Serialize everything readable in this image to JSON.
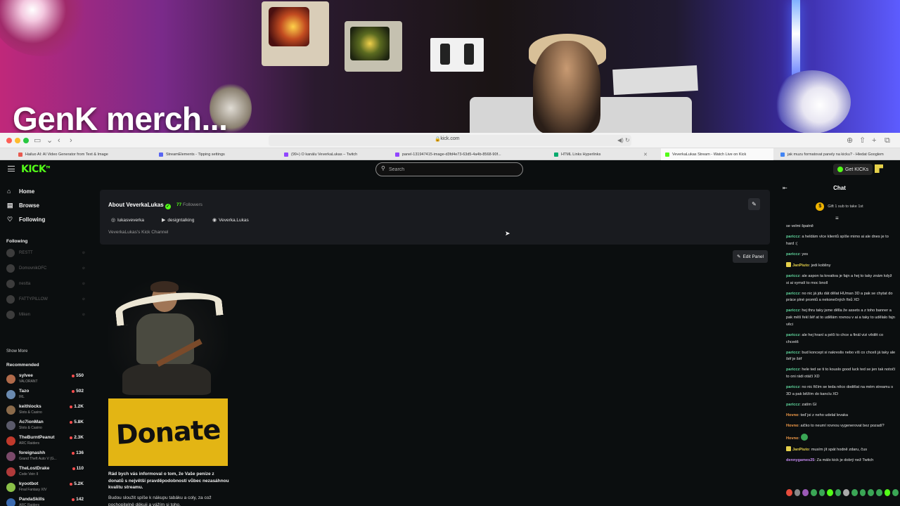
{
  "overlay": {
    "title": "GenK merch..."
  },
  "browser": {
    "url": "kick.com",
    "tabs": [
      {
        "label": "Hailuo AI: AI Video Generator from Text & Image",
        "fav": "#e85a4f"
      },
      {
        "label": "StreamElements - Tipping settings",
        "fav": "#5865f2"
      },
      {
        "label": "(99+) O kanálu VeverkaLukas – Twitch",
        "fav": "#9146ff"
      },
      {
        "label": "panel-131947415-image-d3fd4e73-63d5-4a4b-8568-90f...",
        "fav": "#9146ff"
      },
      {
        "label": "HTML Links Hyperlinks",
        "fav": "#04aa6d"
      },
      {
        "label": "VeverkaLukas Stream - Watch Live on Kick",
        "fav": "#53fc18"
      },
      {
        "label": "jak muzu formatovat panely na kicku? - Hledat Googlem",
        "fav": "#4285f4"
      }
    ]
  },
  "topnav": {
    "logo": "KICK",
    "search_placeholder": "Search",
    "get_kicks": "Get KICKs"
  },
  "sidebar": {
    "nav": [
      {
        "label": "Home",
        "icon": "⌂"
      },
      {
        "label": "Browse",
        "icon": "▤"
      },
      {
        "label": "Following",
        "icon": "♡"
      }
    ],
    "following_heading": "Following",
    "following": [
      "RESTT",
      "DomovnikOFC",
      "nestta",
      "FATTYPILLOW",
      "Miken"
    ],
    "show_more": "Show More",
    "recommended_heading": "Recommended",
    "recommended": [
      {
        "name": "sylvee",
        "category": "VALORANT",
        "viewers": "550",
        "color": "#b06a4a"
      },
      {
        "name": "Tazo",
        "category": "IRL",
        "viewers": "502",
        "color": "#6a8ab0"
      },
      {
        "name": "keithlocks",
        "category": "Slots & Casino",
        "viewers": "1.2K",
        "color": "#8a6a4a"
      },
      {
        "name": "Ac7ionMan",
        "category": "Slots & Casino",
        "viewers": "5.8K",
        "color": "#5a5a6a"
      },
      {
        "name": "TheBurntPeanut",
        "category": "ARC Raiders",
        "viewers": "2.3K",
        "color": "#c0392b"
      },
      {
        "name": "foreignashh",
        "category": "Grand Theft Auto V (G...",
        "viewers": "136",
        "color": "#7a4a6a"
      },
      {
        "name": "TheLostDrake",
        "category": "Code Vein II",
        "viewers": "110",
        "color": "#b03a3a"
      },
      {
        "name": "kyootbot",
        "category": "Final Fantasy XIV",
        "viewers": "5.2K",
        "color": "#8ac048"
      },
      {
        "name": "PandaSkills",
        "category": "ARC Raiders",
        "viewers": "142",
        "color": "#3a6ab0"
      },
      {
        "name": "withJENNY",
        "category": "Just Chatting",
        "viewers": "122",
        "color": "#c08060"
      }
    ]
  },
  "about": {
    "title": "About VeverkaLukas",
    "followers_count": "77",
    "followers_label": "Followers",
    "social": [
      {
        "label": "lukasveverka",
        "icon": "◎"
      },
      {
        "label": "designtalking",
        "icon": "▶"
      },
      {
        "label": "Veverka.Lukas",
        "icon": "◉"
      }
    ],
    "description": "VeverkaLukas's Kick Channel"
  },
  "panel": {
    "edit_label": "Edit Panel",
    "donate_text": "Donate",
    "bold_text": "Rád bych vás informoval o tom, že Vaše peníze z donatů s největší pravděpodobností vůbec nezasáhnou kvalitu streamu.",
    "body_text": "Budou sloužit spíše k nákupu tabáku a coly, za což pochopitelně děkuji a vážím si toho."
  },
  "chat": {
    "title": "Chat",
    "gift_text": "Gift 1 sub to take 1st",
    "messages": [
      {
        "user": "",
        "color": "#e6e6e6",
        "text": "se velmi špatně",
        "badge": false
      },
      {
        "user": "pariccz",
        "color": "#5fd39b",
        "text": "a heldám více klientů spíše mimo ai ale dnes je to hard :(",
        "badge": false
      },
      {
        "user": "pariccz",
        "color": "#5fd39b",
        "text": "yes",
        "badge": false
      },
      {
        "user": "JanPiuto",
        "color": "#e5d04a",
        "text": "jedi kobliny",
        "badge": true
      },
      {
        "user": "pariccz",
        "color": "#5fd39b",
        "text": "ale aspon ta kreativa je fajn a hej to taky znám když si ai vymslí to moc bnoll",
        "badge": false
      },
      {
        "user": "pariccz",
        "color": "#5fd39b",
        "text": "no nic já jdu dát dělat HUman 3D a pak se chytat do práce plné promtů a nekonečných fixů XD",
        "badge": false
      },
      {
        "user": "pariccz",
        "color": "#5fd39b",
        "text": "hej thru taky jsme dělla že assets a z toho banner a pak měš řekl šéf at to udělám rovnou v ai a taky to udělalo fajn věci",
        "badge": false
      },
      {
        "user": "pariccz",
        "color": "#5fd39b",
        "text": "ale hej hraní a péči to chce a finál vizi vědět co chceéš",
        "badge": false
      },
      {
        "user": "pariccz",
        "color": "#5fd39b",
        "text": "bud koncept si nakreslis nebo víš co chceš já taky ale šéf je šéf",
        "badge": false
      },
      {
        "user": "pariccz",
        "color": "#5fd39b",
        "text": "hele ted se ti to kouslo good luck ted se jen tak notočí to oni rádi otáčí XD",
        "badge": false
      },
      {
        "user": "pariccz",
        "color": "#5fd39b",
        "text": "no nic fičím se teda něco dodělat na mém streamu s 3D a pak běžím do kanclu XD",
        "badge": false
      },
      {
        "user": "pariccz",
        "color": "#5fd39b",
        "text": "zatím GI",
        "badge": false
      },
      {
        "user": "Hovno",
        "color": "#f39c4a",
        "text": "teď jsi z neho udelal levaka",
        "badge": false
      },
      {
        "user": "Hovno",
        "color": "#f39c4a",
        "text": "aičko to neumí rovnou vygenerovat bez pozadí?",
        "badge": false
      },
      {
        "user": "Hovno",
        "color": "#f39c4a",
        "text": "",
        "badge": false,
        "emote": true
      },
      {
        "user": "JanPiuto",
        "color": "#e5d04a",
        "text": "musím jít spát hodně zdaru, čus",
        "badge": true
      },
      {
        "user": "dennygames25",
        "color": "#c48af0",
        "text": "Za málo kick je dobrý než Twitch",
        "badge": false
      }
    ]
  }
}
